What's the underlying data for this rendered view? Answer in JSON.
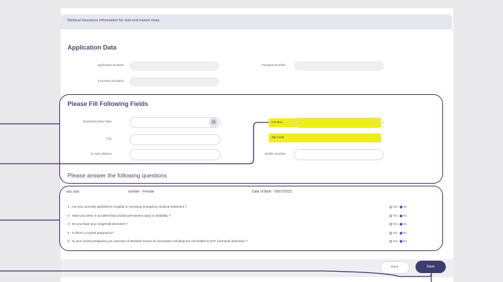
{
  "header": {
    "title": "Medical insurance information for visit and transit visas"
  },
  "application": {
    "title": "Application Data",
    "application_number_label": "Application Number",
    "passport_number_label": "Passport Number",
    "insurance_duration_label": "Insurance Duration"
  },
  "fill": {
    "title": "Please Fill Following Fields",
    "expected_entry_date_label": "Expected Entry Date",
    "city_label": "City",
    "email_label": "E-mail Address",
    "po_box_label": "P.O Box",
    "zip_code_label": "Zip Code",
    "mobile_label": "Mobile Number"
  },
  "questions": {
    "title": "Please answer the following questions",
    "person_name": "aziz aziz",
    "gender": "Gender - Female",
    "dob": "Date of Birth - 05/07/2023",
    "yes_label": "Yes",
    "no_label": "No",
    "items": [
      {
        "text": "1 - Are you currently admitted to hospital or receiving emergency medical treatment ?",
        "answer": "No"
      },
      {
        "text": "2 - Have you been in accident that caused permanent injury or disability ?",
        "answer": "No"
      },
      {
        "text": "3 - Do you have any congenital disorders ?",
        "answer": "No"
      },
      {
        "text": "4 - Is there a current pregnancy?",
        "answer": "No"
      },
      {
        "text": "5 - Is your current pregnancy an outcome of assisted means of conception including but not limited to (IVF, hormonal induction) ?",
        "answer": "No"
      }
    ]
  },
  "footer": {
    "back_label": "Back",
    "save_label": "Save"
  },
  "colors": {
    "accent": "#3c3c6e",
    "highlight": "#f0ee1a",
    "outline": "#4a2a62"
  },
  "icons": {
    "date_picker": "calendar-icon"
  }
}
